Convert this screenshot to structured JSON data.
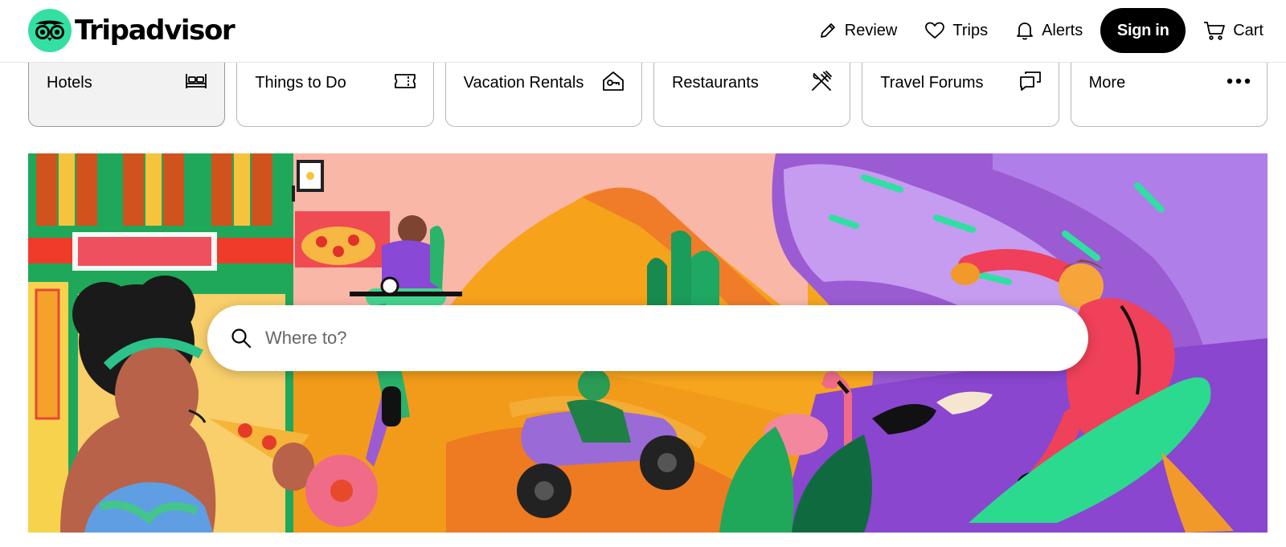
{
  "header": {
    "brand": "Tripadvisor",
    "nav": {
      "review": "Review",
      "trips": "Trips",
      "alerts": "Alerts",
      "sign_in": "Sign in",
      "cart": "Cart"
    }
  },
  "categories": [
    {
      "label": "Hotels",
      "icon": "bed-icon",
      "active": true
    },
    {
      "label": "Things to Do",
      "icon": "ticket-icon"
    },
    {
      "label": "Vacation Rentals",
      "icon": "house-key-icon"
    },
    {
      "label": "Restaurants",
      "icon": "fork-knife-icon"
    },
    {
      "label": "Travel Forums",
      "icon": "chat-bubbles-icon"
    },
    {
      "label": "More",
      "icon": "more-dots-icon"
    }
  ],
  "search": {
    "placeholder": "Where to?"
  },
  "colors": {
    "brand_green": "#34e0a1",
    "signin_bg": "#000000"
  }
}
